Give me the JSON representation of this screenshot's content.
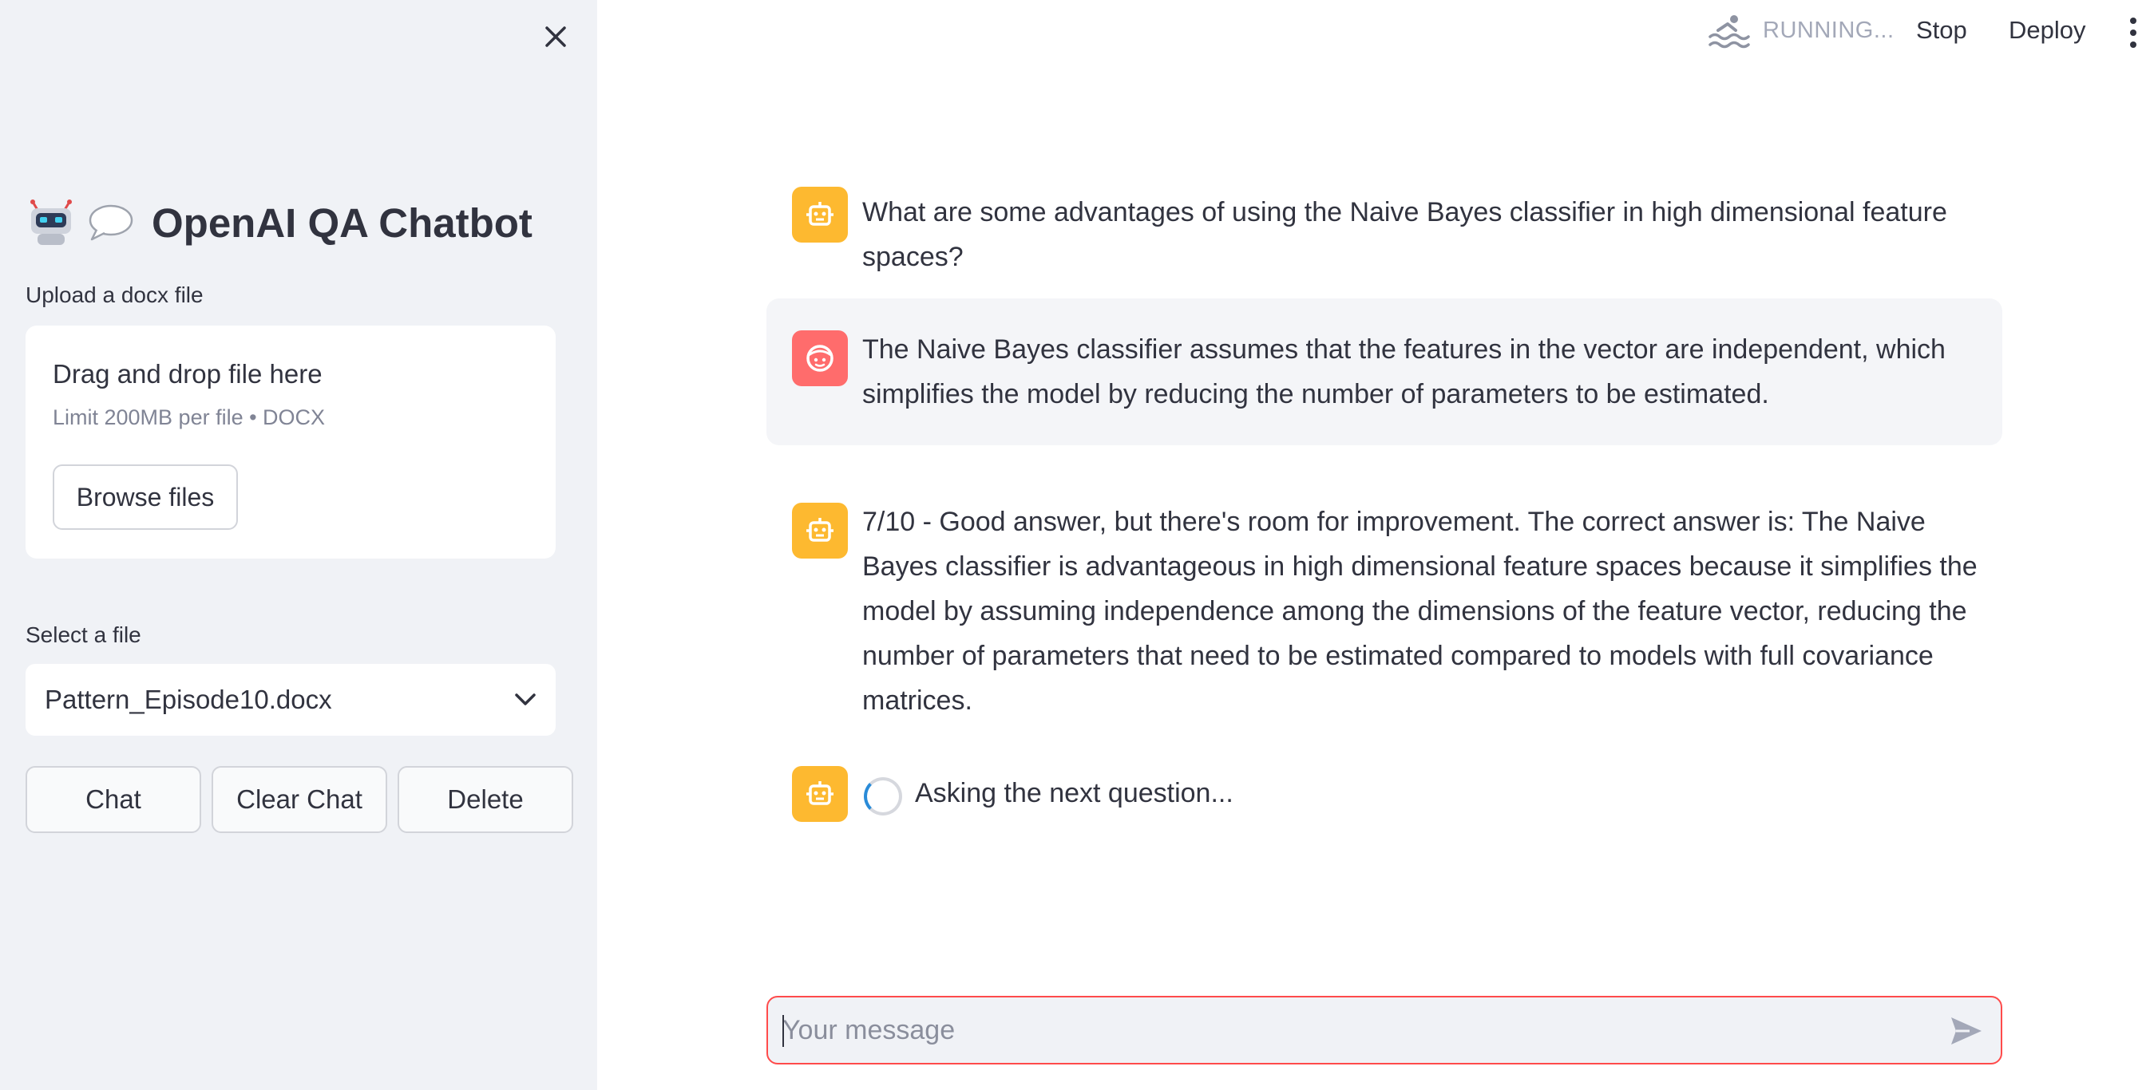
{
  "sidebar": {
    "title": "OpenAI QA Chatbot",
    "upload": {
      "label": "Upload a docx file",
      "dropzone_title": "Drag and drop file here",
      "dropzone_limit": "Limit 200MB per file • DOCX",
      "browse_label": "Browse files"
    },
    "select": {
      "label": "Select a file",
      "value": "Pattern_Episode10.docx"
    },
    "buttons": {
      "chat": "Chat",
      "clear_chat": "Clear Chat",
      "delete": "Delete"
    },
    "icons": [
      "robot-emoji-icon",
      "speech-bubble-icon",
      "close-icon",
      "chevron-down-icon"
    ]
  },
  "header": {
    "status": "RUNNING...",
    "stop": "Stop",
    "deploy": "Deploy",
    "icons": [
      "running-swimmer-icon",
      "kebab-menu-icon"
    ]
  },
  "messages": [
    {
      "role": "assistant",
      "text": "What are some advantages of using the Naive Bayes classifier in high dimensional feature spaces?"
    },
    {
      "role": "user",
      "text": "The Naive Bayes classifier assumes that the features in the vector are independent, which simplifies the model by reducing the number of parameters to be estimated."
    },
    {
      "role": "assistant",
      "text": "7/10 - Good answer, but there's room for improvement. The correct answer is: The Naive Bayes classifier is advantageous in high dimensional feature spaces because it simplifies the model by assuming independence among the dimensions of the feature vector, reducing the number of parameters that need to be estimated compared to models with full covariance matrices."
    },
    {
      "role": "assistant",
      "text": "Asking the next question..."
    }
  ],
  "chat_input": {
    "placeholder": "Your message"
  },
  "colors": {
    "sidebar_bg": "#f0f2f6",
    "bot_avatar": "#fdb930",
    "user_avatar": "#ff6c6c",
    "input_border": "#ff4b4b",
    "spinner": "#2a8bd8"
  }
}
